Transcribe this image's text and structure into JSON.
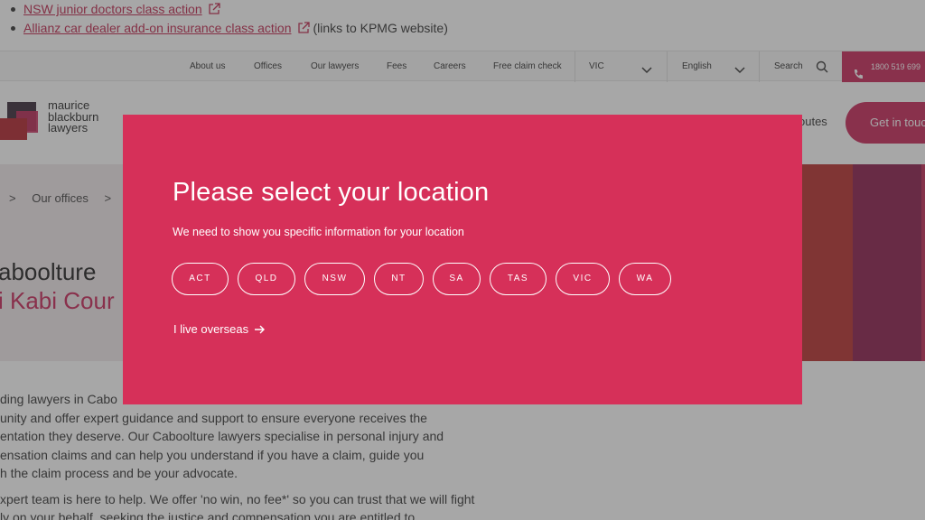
{
  "top_links": [
    {
      "label": "NSW junior doctors class action",
      "note": ""
    },
    {
      "label": "Allianz car dealer add-on insurance class action",
      "note": "(links to KPMG website)"
    }
  ],
  "utility_nav": {
    "links": [
      "About us",
      "Offices",
      "Our lawyers",
      "Fees",
      "Careers",
      "Free claim check"
    ],
    "state_select": "VIC",
    "language_select": "English",
    "search_label": "Search",
    "phone": "1800 519 699"
  },
  "header": {
    "logo_lines": [
      "maurice",
      "blackburn",
      "lawyers"
    ],
    "routes_label": "outes",
    "cta_label": "Get in touc"
  },
  "hero": {
    "breadcrumb": [
      ">",
      "Our offices",
      ">"
    ],
    "title": "aboolture",
    "subtitle": "i Kabi Cour"
  },
  "body_paragraphs": [
    [
      "ding lawyers in Cabo",
      "unity and offer expert guidance and support to ensure everyone receives the",
      "entation they deserve. Our Caboolture lawyers specialise in personal injury and",
      "ensation claims and can help you understand if you have a claim, guide you",
      "h the claim process and be your advocate."
    ],
    [
      "xpert team is here to help. We offer 'no win, no fee*' so you can trust that we will fight",
      "ly on your behalf, seeking the justice and compensation you are entitled to."
    ]
  ],
  "modal": {
    "title": "Please select your location",
    "description": "We need to show you specific information for your location",
    "states": [
      "ACT",
      "QLD",
      "NSW",
      "NT",
      "SA",
      "TAS",
      "VIC",
      "WA"
    ],
    "overseas_label": "I live overseas"
  },
  "colors": {
    "brand": "#c8285a",
    "modal_bg": "#d63059",
    "hero_stripes": [
      "#b8302f",
      "#8d1e4d",
      "#c22a57"
    ]
  }
}
